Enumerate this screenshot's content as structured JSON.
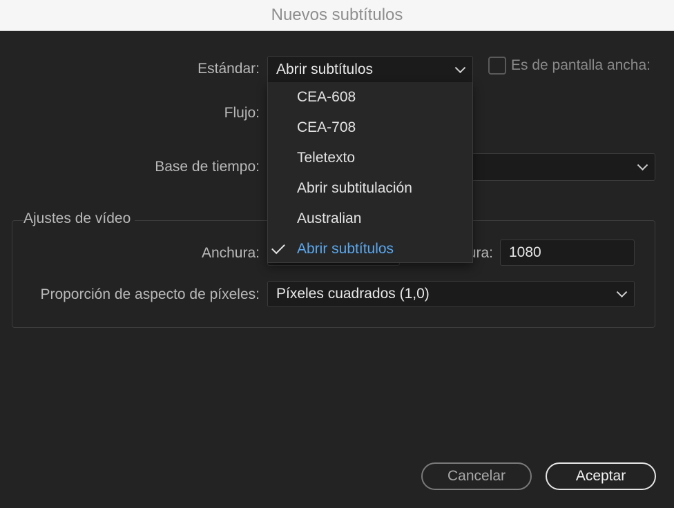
{
  "window": {
    "title": "Nuevos subtítulos"
  },
  "standard": {
    "label": "Estándar:",
    "value": "Abrir subtítulos"
  },
  "widescreen": {
    "label": "Es de pantalla ancha:",
    "checked": false
  },
  "stream": {
    "label": "Flujo:"
  },
  "timebase": {
    "label": "Base de tiempo:"
  },
  "video_settings": {
    "title": "Ajustes de vídeo",
    "width_label": "Anchura:",
    "height_label_visible": "ura:",
    "height_value": "1080",
    "par_label": "Proporción de aspecto de píxeles:",
    "par_value": "Píxeles cuadrados (1,0)"
  },
  "dropdown": {
    "items": [
      {
        "label": "CEA-608",
        "selected": false
      },
      {
        "label": "CEA-708",
        "selected": false
      },
      {
        "label": "Teletexto",
        "selected": false
      },
      {
        "label": "Abrir subtitulación",
        "selected": false
      },
      {
        "label": "Australian",
        "selected": false
      },
      {
        "label": "Abrir subtítulos",
        "selected": true
      }
    ]
  },
  "buttons": {
    "cancel": "Cancelar",
    "ok": "Aceptar"
  },
  "colors": {
    "background": "#232323",
    "accent": "#5aa8f0"
  }
}
